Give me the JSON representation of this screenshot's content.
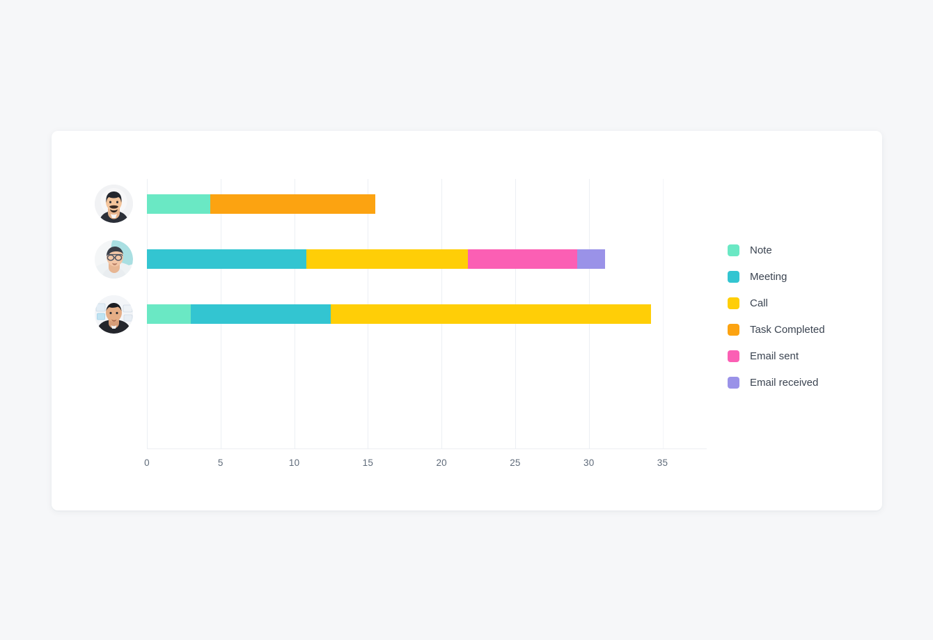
{
  "card": {
    "title": ""
  },
  "legend": {
    "position": "right",
    "items": [
      {
        "label": "Note",
        "color": "#6AE8C4",
        "icon": "legend-swatch-icon"
      },
      {
        "label": "Meeting",
        "color": "#33C5D1",
        "icon": "legend-swatch-icon"
      },
      {
        "label": "Call",
        "color": "#FFCE07",
        "icon": "legend-swatch-icon"
      },
      {
        "label": "Task Completed",
        "color": "#FCA311",
        "icon": "legend-swatch-icon"
      },
      {
        "label": "Email sent",
        "color": "#FB5FB4",
        "icon": "legend-swatch-icon"
      },
      {
        "label": "Email received",
        "color": "#9A92E8",
        "icon": "legend-swatch-icon"
      }
    ]
  },
  "axis": {
    "ticks": [
      "0",
      "5",
      "10",
      "15",
      "20",
      "25",
      "30",
      "35"
    ],
    "tick_values": [
      0,
      5,
      10,
      15,
      20,
      25,
      30,
      35
    ]
  },
  "rows": [
    {
      "avatar": "avatar-user-1",
      "avatar_alt": "man with beard and dark shirt"
    },
    {
      "avatar": "avatar-user-2",
      "avatar_alt": "older man with glasses"
    },
    {
      "avatar": "avatar-user-3",
      "avatar_alt": "man with short dark hair in dark shirt"
    }
  ],
  "chart_data": {
    "type": "bar",
    "orientation": "horizontal",
    "stacked": true,
    "title": "",
    "xlabel": "",
    "ylabel": "",
    "xlim": [
      0,
      38
    ],
    "grid": true,
    "legend_position": "right",
    "categories": [
      "User 1",
      "User 2",
      "User 3"
    ],
    "series": [
      {
        "name": "Note",
        "color": "#6AE8C4",
        "values": [
          4.3,
          0,
          3
        ]
      },
      {
        "name": "Meeting",
        "color": "#33C5D1",
        "values": [
          0,
          10.8,
          9.5
        ]
      },
      {
        "name": "Call",
        "color": "#FFCE07",
        "values": [
          0,
          11,
          21.7
        ]
      },
      {
        "name": "Task Completed",
        "color": "#FCA311",
        "values": [
          11.2,
          0,
          0
        ]
      },
      {
        "name": "Email sent",
        "color": "#FB5FB4",
        "values": [
          0,
          7.4,
          0
        ]
      },
      {
        "name": "Email received",
        "color": "#9A92E8",
        "values": [
          0,
          1.9,
          0
        ]
      }
    ],
    "row_totals": [
      15.5,
      31.1,
      34.2
    ]
  },
  "colors": {
    "page_background": "#f6f7f9",
    "card_background": "#ffffff",
    "gridline": "#eceff3",
    "tick_text": "#5f6b7a",
    "legend_text": "#3b4451"
  }
}
